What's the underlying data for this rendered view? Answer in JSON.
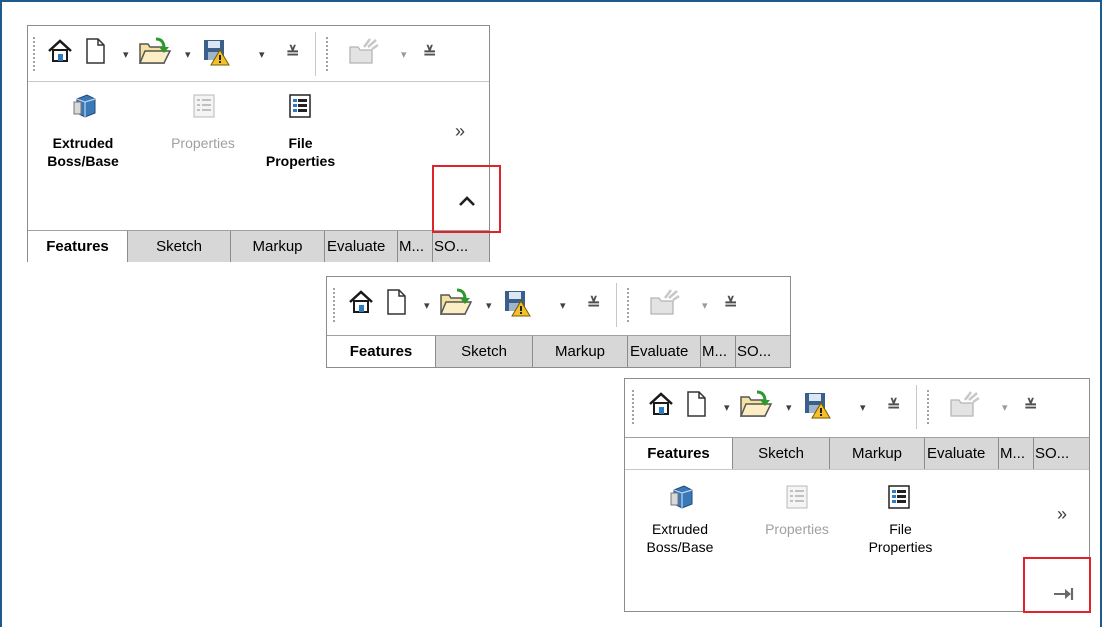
{
  "toolbar": {
    "icons": [
      "home-icon",
      "new-document-icon",
      "open-folder-icon",
      "save-icon",
      "customize-icon",
      "sw-options-icon"
    ]
  },
  "commands": {
    "extruded": "Extruded\nBoss/Base",
    "properties": "Properties",
    "file_properties": "File\nProperties",
    "more": "»"
  },
  "tabs": [
    "Features",
    "Sketch",
    "Markup",
    "Evaluate",
    "M...",
    "SO..."
  ],
  "controls": {
    "collapse": "^",
    "pin": "→|"
  },
  "colors": {
    "highlight": "#e0232a",
    "frame": "#1f5a8c",
    "tab_inactive": "#d7d7d7"
  }
}
